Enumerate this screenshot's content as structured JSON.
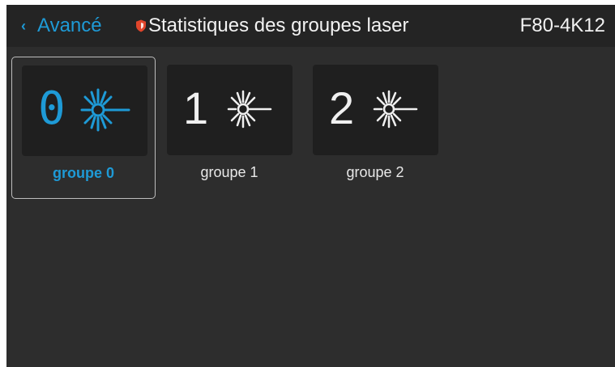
{
  "header": {
    "back_label": "Avancé",
    "title": "Statistiques des groupes laser",
    "model": "F80-4K12"
  },
  "groups": [
    {
      "number": "0",
      "label": "groupe 0",
      "selected": true
    },
    {
      "number": "1",
      "label": "groupe 1",
      "selected": false
    },
    {
      "number": "2",
      "label": "groupe 2",
      "selected": false
    }
  ],
  "colors": {
    "accent": "#1e9ad6",
    "background": "#2d2d2d",
    "header_background": "#242424",
    "tile_background": "#1f1f1f",
    "shield": "#e0452b"
  },
  "icons": {
    "back": "chevron-left-icon",
    "restricted": "shield-icon",
    "laser": "laser-icon"
  }
}
